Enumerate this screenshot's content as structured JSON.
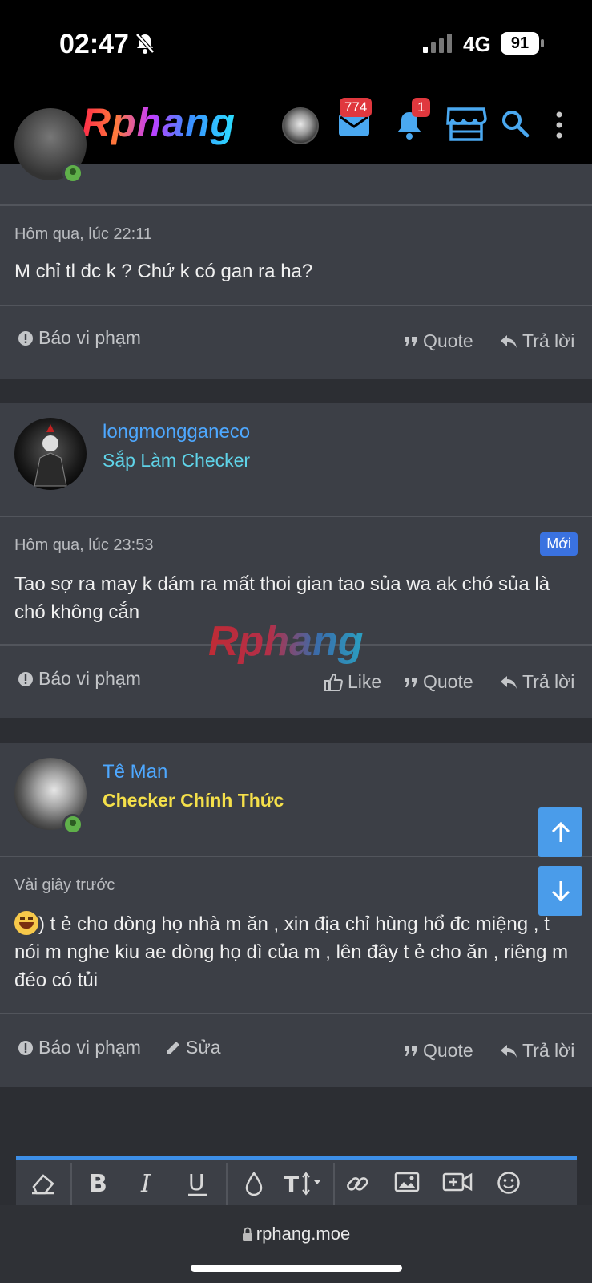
{
  "status_bar": {
    "time": "02:47",
    "network": "4G",
    "battery": "91"
  },
  "header": {
    "logo": "Rphang",
    "mail_count": "774",
    "notification_count": "1"
  },
  "top_post_tail": {
    "timestamp": "Hôm qua, lúc 22:11",
    "content": "M chỉ tl đc k ? Chứ k có gan ra ha?",
    "report_label": "Báo vi phạm",
    "quote_label": "Quote",
    "reply_label": "Trả lời"
  },
  "post_2": {
    "username": "longmongganeco",
    "user_title": "Sắp Làm Checker",
    "user_title_color": "#5fd3e8",
    "timestamp": "Hôm qua, lúc 23:53",
    "new_badge": "Mới",
    "content": "Tao sợ ra may k dám ra mất thoi gian tao sủa wa ak chó sủa là chó không cắn",
    "report_label": "Báo vi phạm",
    "like_label": "Like",
    "quote_label": "Quote",
    "reply_label": "Trả lời"
  },
  "post_3": {
    "username": "Tê Man",
    "user_title": "Checker Chính Thức",
    "user_title_color": "#f5e04a",
    "timestamp": "Vài giây trước",
    "content": ") t ẻ cho dòng họ nhà m ăn , xin địa chỉ hùng hổ đc miệng , t nói m nghe kiu ae dòng họ dì của m , lên đây t ẻ cho ăn , riêng m đéo có tủi",
    "report_label": "Báo vi phạm",
    "edit_label": "Sửa",
    "quote_label": "Quote",
    "reply_label": "Trả lời"
  },
  "watermark": "Rphang",
  "browser": {
    "url": "rphang.moe"
  }
}
